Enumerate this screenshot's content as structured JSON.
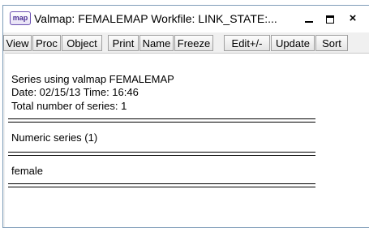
{
  "window": {
    "title": "Valmap: FEMALEMAP   Workfile: LINK_STATE:...",
    "icon_label": "map",
    "controls": {
      "minimize": "minimize-icon",
      "maximize": "maximize-icon",
      "close": "×"
    }
  },
  "toolbar": {
    "buttons": [
      "View",
      "Proc",
      "Object",
      "Print",
      "Name",
      "Freeze",
      "Edit+/-",
      "Update",
      "Sort"
    ]
  },
  "content": {
    "header_lines": [
      "Series using valmap FEMALEMAP",
      "Date: 02/15/13   Time: 16:46",
      "Total number of series: 1"
    ],
    "section_title": "Numeric series (1)",
    "series": [
      "female"
    ]
  },
  "colors": {
    "window_border": "#7f9db9",
    "toolbar_bg": "#f0f0f0",
    "icon_accent": "#4b2e95"
  }
}
